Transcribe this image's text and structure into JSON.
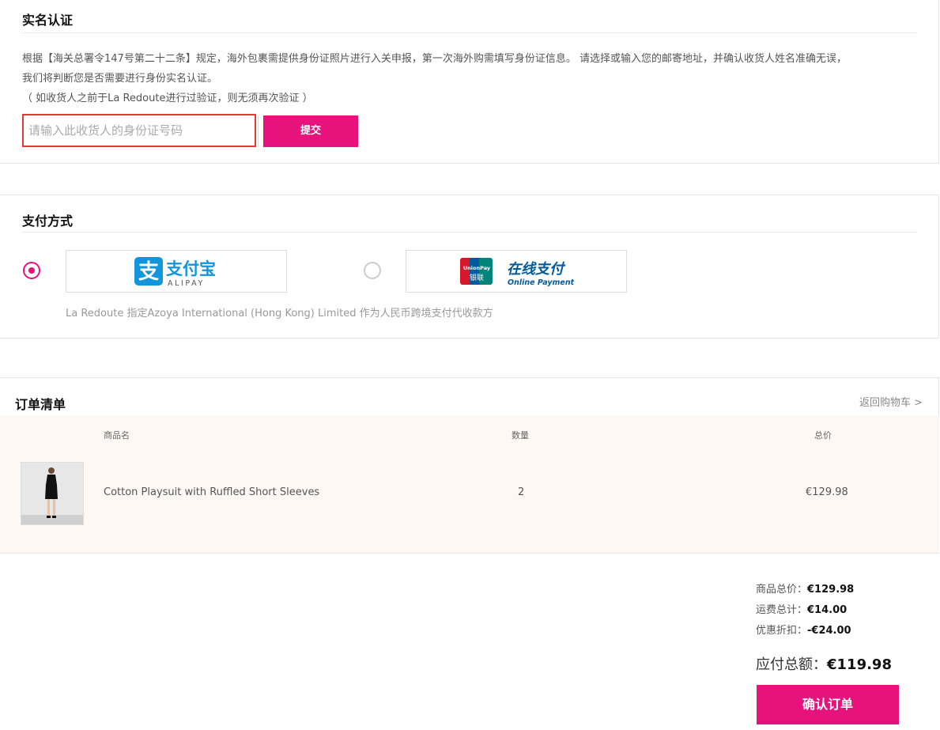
{
  "id_verification": {
    "title": "实名认证",
    "desc_line1": "根据【海关总署令147号第二十二条】规定，海外包裹需提供身份证照片进行入关申报，第一次海外购需填写身份证信息。 请选择或输入您的邮寄地址，并确认收货人姓名准确无误，",
    "desc_line2": "我们将判断您是否需要进行身份实名认证。",
    "desc_line3": "（ 如收货人之前于La Redoute进行过验证，则无须再次验证 ）",
    "input_placeholder": "请输入此收货人的身份证号码",
    "submit_label": "提交"
  },
  "payment": {
    "title": "支付方式",
    "options": [
      {
        "name": "支付宝",
        "sub": "ALIPAY",
        "selected": true
      },
      {
        "name": "在线支付",
        "sub": "Online Payment",
        "badge_top": "UnionPay",
        "badge_bottom": "银联",
        "selected": false
      }
    ],
    "note": "La Redoute 指定Azoya International (Hong Kong) Limited 作为人民币跨境支付代收款方"
  },
  "order": {
    "title": "订单清单",
    "back_link": "返回购物车 >",
    "columns": [
      "商品名",
      "数量",
      "总价"
    ],
    "items": [
      {
        "name": "Cotton Playsuit with Ruffled Short Sleeves",
        "qty": "2",
        "price": "€129.98"
      }
    ]
  },
  "summary": {
    "subtotal_label": "商品总价：",
    "subtotal": "€129.98",
    "shipping_label": "运费总计：",
    "shipping": "€14.00",
    "discount_label": "优惠折扣：",
    "discount": "-€24.00",
    "total_label": "应付总额：",
    "total": "€119.98",
    "confirm_label": "确认订单"
  },
  "colors": {
    "accent": "#e8127c",
    "alipay_blue": "#1296db",
    "unionpay_red": "#d7182a",
    "unionpay_blue": "#005b9c"
  }
}
